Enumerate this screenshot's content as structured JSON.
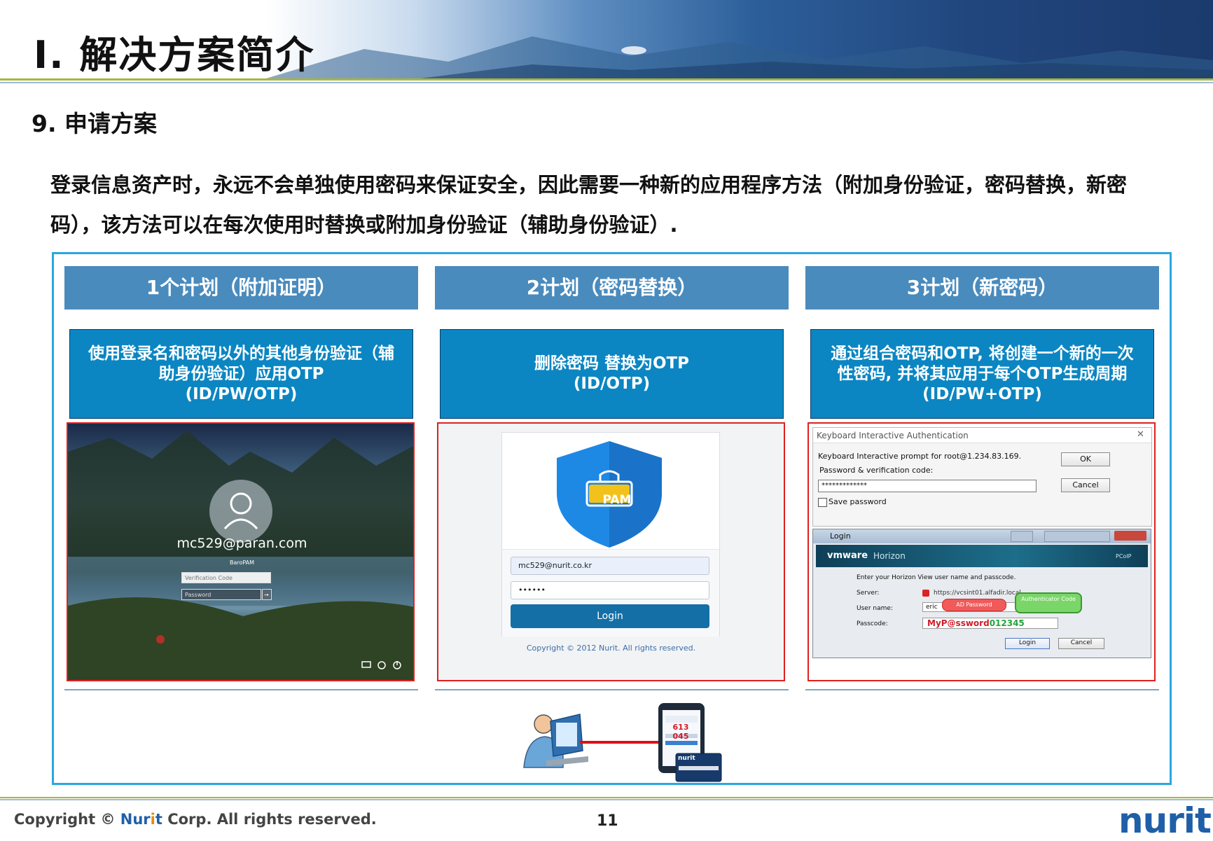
{
  "header": {
    "page_title": "Ⅰ. 解决方案简介",
    "section_title": "9. 申请方案"
  },
  "intro_text": "登录信息资产时，永远不会单独使用密码来保证安全，因此需要一种新的应用程序方法（附加身份验证，密码替换，新密码），该方法可以在每次使用时替换或附加身份验证（辅助身份验证）.",
  "plans": [
    {
      "title": "1个计划（附加证明）",
      "desc_lines": [
        "使用登录名和密码以外的其他身份验证（辅",
        "助身份验证）应用OTP",
        "(ID/PW/OTP)"
      ],
      "screen": {
        "username": "mc529@paran.com",
        "app_name": "BaroPAM",
        "code_placeholder": "Verification Code",
        "password_placeholder": "Password",
        "arrow": "→"
      }
    },
    {
      "title": "2计划（密码替换）",
      "desc_lines": [
        "删除密码 替换为OTP",
        "(ID/OTP)"
      ],
      "screen": {
        "badge": "PAM",
        "email": "mc529@nurit.co.kr",
        "password": "••••••",
        "login_button": "Login",
        "copyright": "Copyright © 2012 Nurit. All rights reserved."
      }
    },
    {
      "title": "3计划（新密码）",
      "desc_lines": [
        "通过组合密码和OTP, 将创建一个新的一次",
        "性密码, 并将其应用于每个OTP生成周期",
        "(ID/PW+OTP)"
      ],
      "screen": {
        "dialog_title": "Keyboard Interactive Authentication",
        "close": "✕",
        "prompt": "Keyboard Interactive prompt for root@1.234.83.169.",
        "field_label": "Password & verification code:",
        "field_value": "*************",
        "ok": "OK",
        "cancel": "Cancel",
        "save_password": "Save password",
        "login_title": "Login",
        "vmware": "vmware",
        "horizon": "Horizon",
        "pcoip": "PCoIP",
        "instruction": "Enter your Horizon View user name and passcode.",
        "server_label": "Server:",
        "server_value": "https://vcsint01.alfadir.local",
        "user_label": "User name:",
        "user_value": "eric",
        "passcode_label": "Passcode:",
        "passcode_pw": "MyP@ssword",
        "passcode_otp": "012345",
        "callout_pw": "AD Password",
        "callout_otp": "Authenticator Code",
        "login_button": "Login",
        "cancel_button": "Cancel"
      }
    }
  ],
  "device": {
    "otp_value": "613 045",
    "card_brand": "nurit"
  },
  "footer": {
    "copyright_pre": "Copyright © ",
    "copyright_brand_a": "Nur",
    "copyright_brand_b": "i",
    "copyright_brand_c": "t",
    "copyright_post": " Corp. All rights reserved.",
    "page_number": "11",
    "logo": "nurit"
  },
  "colors": {
    "panel_header": "#4a8bbd",
    "panel_desc": "#0b86c2",
    "frame_border": "#2aa7e0",
    "screenshot_border": "#e02020",
    "brand_blue": "#1f5fa8",
    "accent_olive": "#a7b83a"
  }
}
